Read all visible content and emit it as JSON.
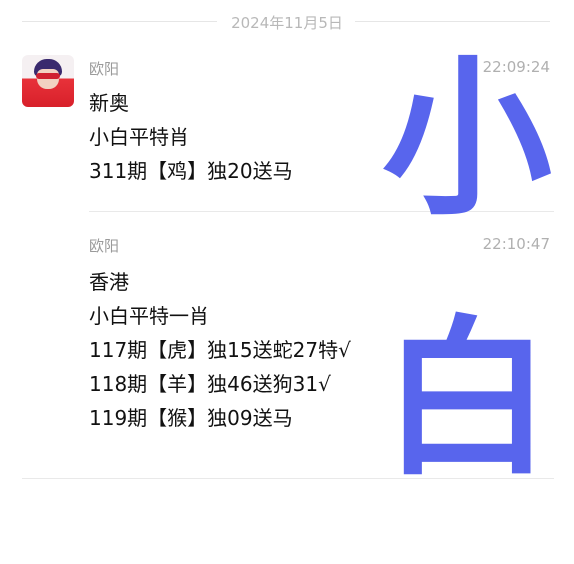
{
  "chat": {
    "date": "2024年11月5日",
    "messages": [
      {
        "sender": "欧阳",
        "time": "22:09:24",
        "lines": [
          "新奥",
          "小白平特肖",
          "311期【鸡】独20送马"
        ]
      },
      {
        "sender": "欧阳",
        "time": "22:10:47",
        "lines": [
          "香港",
          "小白平特一肖",
          "117期【虎】独15送蛇27特√",
          "118期【羊】独46送狗31√",
          "119期【猴】独09送马"
        ]
      }
    ]
  },
  "watermark": {
    "text": [
      "小",
      "白"
    ],
    "color": "#4a58ec"
  }
}
